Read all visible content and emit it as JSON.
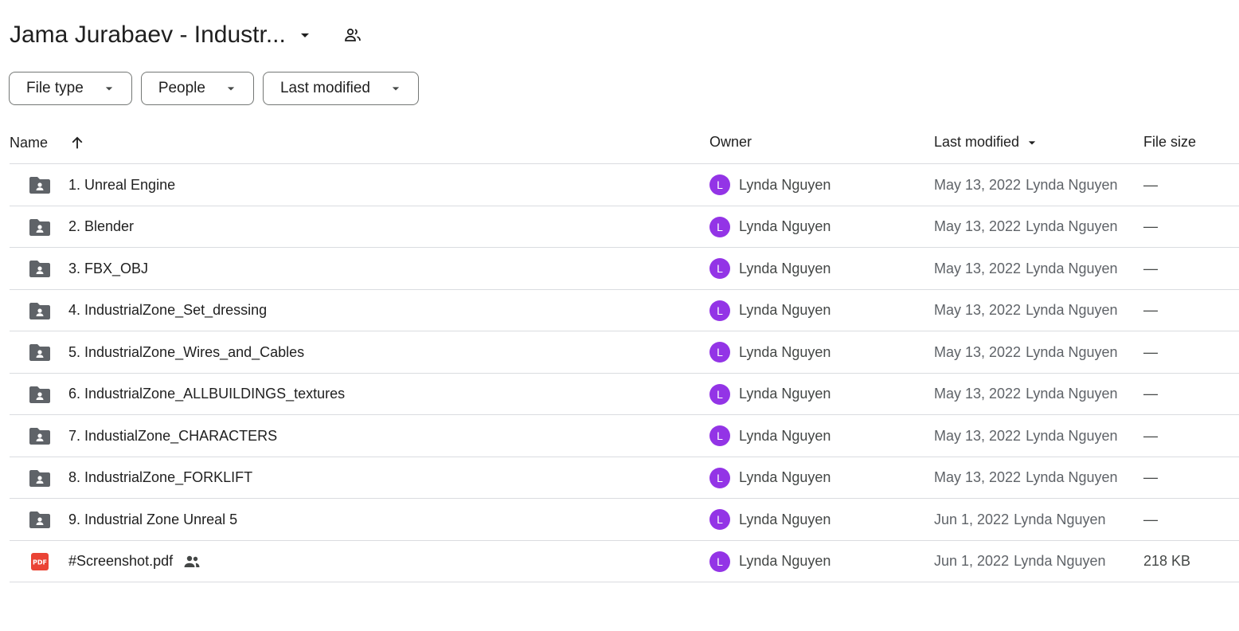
{
  "header": {
    "title": "Jama Jurabaev - Industr...",
    "title_dropdown_icon": "arrow-drop-down-icon",
    "share_icon": "people-outline-icon"
  },
  "filters": [
    {
      "label": "File type"
    },
    {
      "label": "People"
    },
    {
      "label": "Last modified"
    }
  ],
  "table": {
    "columns": {
      "name": "Name",
      "owner": "Owner",
      "last_modified": "Last modified",
      "file_size": "File size"
    },
    "rows": [
      {
        "name": "1. Unreal Engine",
        "type": "shared-folder",
        "owner_initial": "L",
        "owner": "Lynda Nguyen",
        "modified_date": "May 13, 2022",
        "modified_by": "Lynda Nguyen",
        "size": "—"
      },
      {
        "name": "2. Blender",
        "type": "shared-folder",
        "owner_initial": "L",
        "owner": "Lynda Nguyen",
        "modified_date": "May 13, 2022",
        "modified_by": "Lynda Nguyen",
        "size": "—"
      },
      {
        "name": "3. FBX_OBJ",
        "type": "shared-folder",
        "owner_initial": "L",
        "owner": "Lynda Nguyen",
        "modified_date": "May 13, 2022",
        "modified_by": "Lynda Nguyen",
        "size": "—"
      },
      {
        "name": "4. IndustrialZone_Set_dressing",
        "type": "shared-folder",
        "owner_initial": "L",
        "owner": "Lynda Nguyen",
        "modified_date": "May 13, 2022",
        "modified_by": "Lynda Nguyen",
        "size": "—"
      },
      {
        "name": "5. IndustrialZone_Wires_and_Cables",
        "type": "shared-folder",
        "owner_initial": "L",
        "owner": "Lynda Nguyen",
        "modified_date": "May 13, 2022",
        "modified_by": "Lynda Nguyen",
        "size": "—"
      },
      {
        "name": "6. IndustrialZone_ALLBUILDINGS_textures",
        "type": "shared-folder",
        "owner_initial": "L",
        "owner": "Lynda Nguyen",
        "modified_date": "May 13, 2022",
        "modified_by": "Lynda Nguyen",
        "size": "—"
      },
      {
        "name": "7. IndustialZone_CHARACTERS",
        "type": "shared-folder",
        "owner_initial": "L",
        "owner": "Lynda Nguyen",
        "modified_date": "May 13, 2022",
        "modified_by": "Lynda Nguyen",
        "size": "—"
      },
      {
        "name": "8. IndustrialZone_FORKLIFT",
        "type": "shared-folder",
        "owner_initial": "L",
        "owner": "Lynda Nguyen",
        "modified_date": "May 13, 2022",
        "modified_by": "Lynda Nguyen",
        "size": "—"
      },
      {
        "name": "9. Industrial Zone Unreal 5",
        "type": "shared-folder",
        "owner_initial": "L",
        "owner": "Lynda Nguyen",
        "modified_date": "Jun 1, 2022",
        "modified_by": "Lynda Nguyen",
        "size": "—"
      },
      {
        "name": "#Screenshot.pdf",
        "type": "pdf",
        "shared": true,
        "owner_initial": "L",
        "owner": "Lynda Nguyen",
        "modified_date": "Jun 1, 2022",
        "modified_by": "Lynda Nguyen",
        "size": "218 KB"
      }
    ]
  },
  "icons": {
    "folder": "shared-folder-icon",
    "pdf": "pdf-icon",
    "pdf_text": "PDF",
    "shared": "people-icon",
    "sort": "arrow-upward-icon"
  },
  "colors": {
    "avatar": "#9334e6",
    "folder": "#5f6368",
    "pdf": "#ea4335",
    "divider": "#dadce0"
  }
}
